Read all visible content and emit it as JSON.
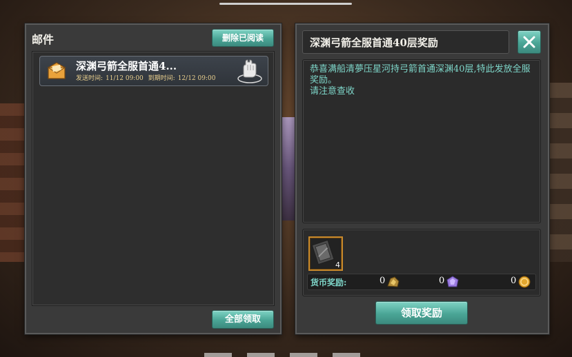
{
  "mailbox": {
    "title": "邮件",
    "delete_read_label": "删除已阅读",
    "claim_all_label": "全部领取",
    "items": [
      {
        "title": "深渊弓箭全服首通4...",
        "sent_label": "发送时间:",
        "sent_value": "11/12 09:00",
        "expire_label": "到期时间:",
        "expire_value": "12/12 09:00"
      }
    ]
  },
  "detail": {
    "title": "深渊弓箭全服首通40层奖励",
    "close_icon": "close-icon",
    "content_line1": "恭喜满船清夢压星河持弓箭首通深渊40层,特此发放全服奖励。",
    "content_line2": "请注意查收",
    "reward_item": {
      "icon": "scroll-card-icon",
      "count": "4"
    },
    "currency_label": "货币奖励:",
    "currencies": [
      {
        "icon": "gold-ore-icon",
        "value": "0"
      },
      {
        "icon": "purple-crystal-icon",
        "value": "0"
      },
      {
        "icon": "gold-coin-icon",
        "value": "0"
      }
    ],
    "claim_label": "领取奖励"
  },
  "colors": {
    "accent_teal": "#4aa596",
    "text_teal": "#7ed6c9",
    "meta_gold": "#e9cf8e",
    "panel_bg": "#3a3a3a"
  }
}
